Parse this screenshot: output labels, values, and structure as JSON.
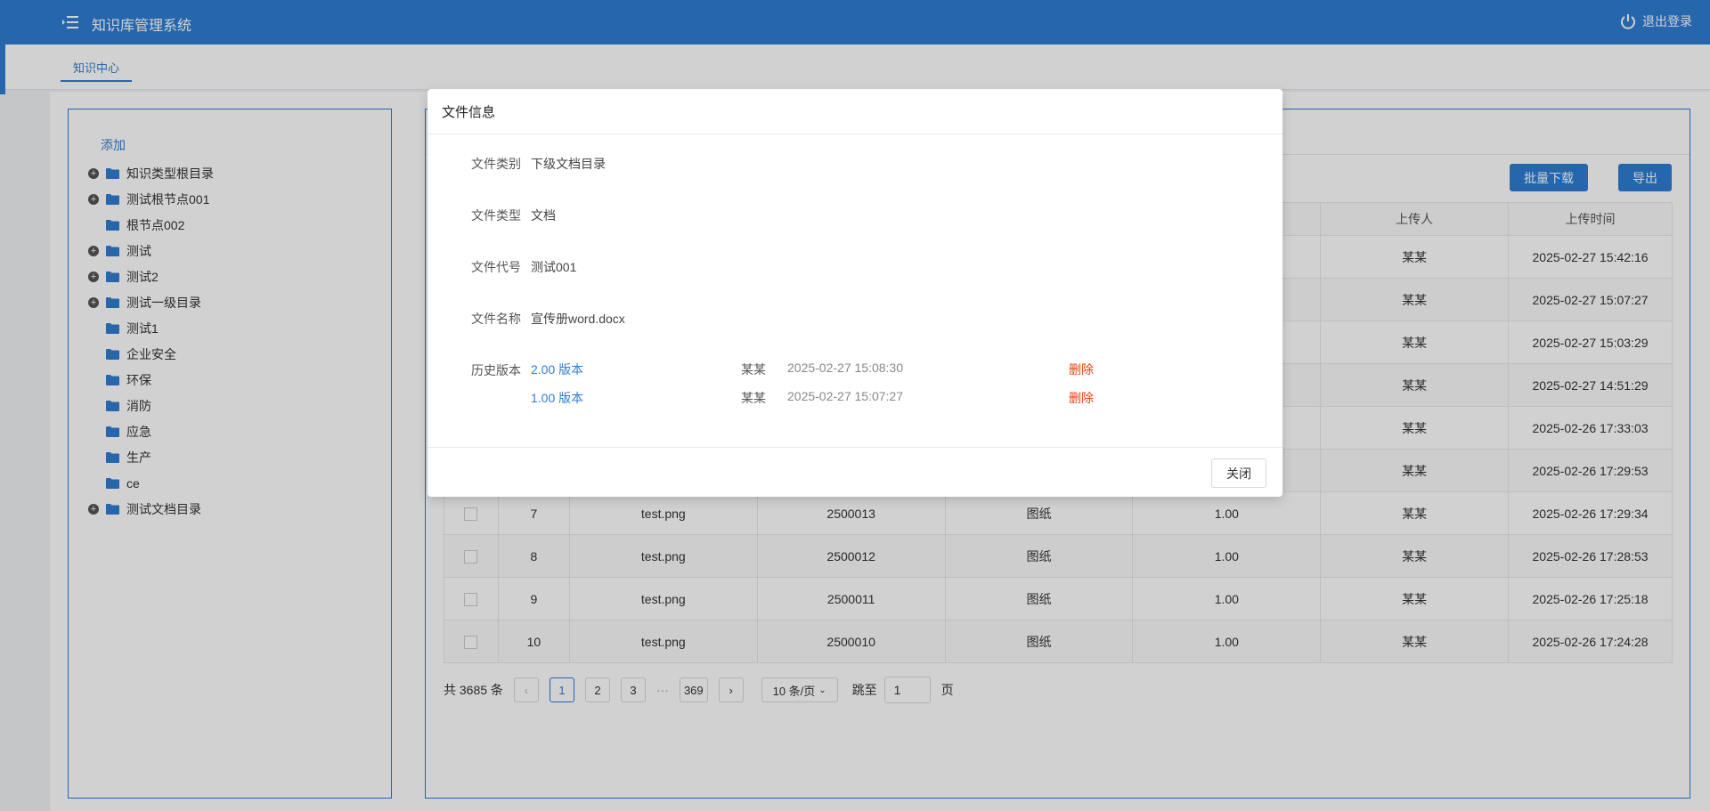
{
  "header": {
    "title": "知识库管理系统",
    "logout_label": "退出登录"
  },
  "tabs": [
    {
      "label": "知识中心"
    }
  ],
  "tree": {
    "add_label": "添加",
    "nodes": [
      {
        "label": "知识类型根目录",
        "expandable": true
      },
      {
        "label": "测试根节点001",
        "expandable": true
      },
      {
        "label": "根节点002",
        "expandable": false
      },
      {
        "label": "测试",
        "expandable": true
      },
      {
        "label": "测试2",
        "expandable": true
      },
      {
        "label": "测试一级目录",
        "expandable": true
      },
      {
        "label": "测试1",
        "expandable": false
      },
      {
        "label": "企业安全",
        "expandable": false
      },
      {
        "label": "环保",
        "expandable": false
      },
      {
        "label": "消防",
        "expandable": false
      },
      {
        "label": "应急",
        "expandable": false
      },
      {
        "label": "生产",
        "expandable": false
      },
      {
        "label": "ce",
        "expandable": false
      },
      {
        "label": "测试文档目录",
        "expandable": true
      }
    ]
  },
  "toolbar": {
    "batch_download_label": "批量下载",
    "export_label": "导出"
  },
  "table": {
    "headers": [
      "",
      "",
      "",
      "",
      "",
      "",
      "上传人",
      "上传时间"
    ],
    "rows": [
      {
        "index": "",
        "name": "",
        "code": "",
        "type": "",
        "version": "",
        "uploader": "某某",
        "time": "2025-02-27 15:42:16"
      },
      {
        "index": "",
        "name": "",
        "code": "",
        "type": "",
        "version": "",
        "uploader": "某某",
        "time": "2025-02-27 15:07:27"
      },
      {
        "index": "",
        "name": "",
        "code": "",
        "type": "",
        "version": "",
        "uploader": "某某",
        "time": "2025-02-27 15:03:29"
      },
      {
        "index": "",
        "name": "",
        "code": "",
        "type": "",
        "version": "",
        "uploader": "某某",
        "time": "2025-02-27 14:51:29"
      },
      {
        "index": "",
        "name": "",
        "code": "",
        "type": "",
        "version": "",
        "uploader": "某某",
        "time": "2025-02-26 17:33:03"
      },
      {
        "index": "",
        "name": "",
        "code": "",
        "type": "",
        "version": "",
        "uploader": "某某",
        "time": "2025-02-26 17:29:53"
      },
      {
        "index": "7",
        "name": "test.png",
        "code": "2500013",
        "type": "图纸",
        "version": "1.00",
        "uploader": "某某",
        "time": "2025-02-26 17:29:34"
      },
      {
        "index": "8",
        "name": "test.png",
        "code": "2500012",
        "type": "图纸",
        "version": "1.00",
        "uploader": "某某",
        "time": "2025-02-26 17:28:53"
      },
      {
        "index": "9",
        "name": "test.png",
        "code": "2500011",
        "type": "图纸",
        "version": "1.00",
        "uploader": "某某",
        "time": "2025-02-26 17:25:18"
      },
      {
        "index": "10",
        "name": "test.png",
        "code": "2500010",
        "type": "图纸",
        "version": "1.00",
        "uploader": "某某",
        "time": "2025-02-26 17:24:28"
      }
    ]
  },
  "pagination": {
    "total_label": "共 3685 条",
    "prev": "‹",
    "pages": [
      "1",
      "2",
      "3"
    ],
    "ellipsis": "···",
    "last_page": "369",
    "next": "›",
    "page_size": "10 条/页",
    "jump_label": "跳至",
    "jump_value": "1",
    "page_suffix": "页"
  },
  "modal": {
    "title": "文件信息",
    "fields": [
      {
        "label": "文件类别",
        "value": "下级文档目录"
      },
      {
        "label": "文件类型",
        "value": "文档"
      },
      {
        "label": "文件代号",
        "value": "测试001"
      },
      {
        "label": "文件名称",
        "value": "宣传册word.docx"
      }
    ],
    "history_label": "历史版本",
    "versions": [
      {
        "version": "2.00 版本",
        "user": "某某",
        "time": "2025-02-27 15:08:30",
        "delete": "删除"
      },
      {
        "version": "1.00 版本",
        "user": "某某",
        "time": "2025-02-27 15:07:27",
        "delete": "删除"
      }
    ],
    "close_label": "关闭"
  },
  "colors": {
    "primary": "#2f7dd4",
    "danger": "#e8410f"
  }
}
